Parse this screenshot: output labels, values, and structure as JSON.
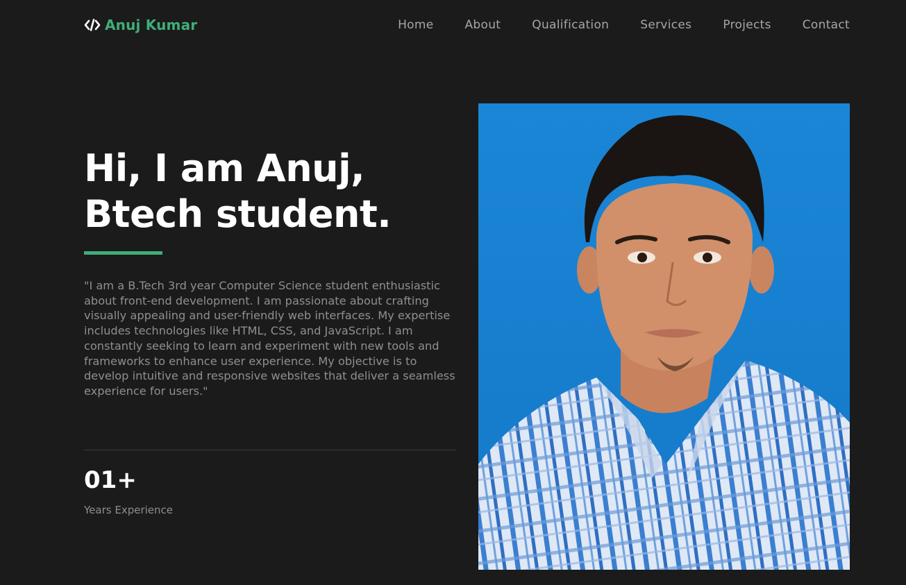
{
  "header": {
    "logo_icon": "code-icon",
    "logo_text": "Anuj Kumar",
    "brand_color": "#3fae79",
    "nav": [
      {
        "label": "Home"
      },
      {
        "label": "About"
      },
      {
        "label": "Qualification"
      },
      {
        "label": "Services"
      },
      {
        "label": "Projects"
      },
      {
        "label": "Contact"
      }
    ]
  },
  "hero": {
    "headline_line1": "Hi, I am Anuj,",
    "headline_line2": "Btech student.",
    "bio": "\"I am a B.Tech 3rd year Computer Science student enthusiastic about front-end development. I am passionate about crafting visually appealing and user-friendly web interfaces. My expertise includes technologies like HTML, CSS, and JavaScript. I am constantly seeking to learn and experiment with new tools and frameworks to enhance user experience. My objective is to develop intuitive and responsive websites that deliver a seamless experience for users.\"",
    "stat": {
      "value": "01+",
      "label": "Years Experience"
    }
  },
  "photo": {
    "background_color": "#1a84d4"
  }
}
